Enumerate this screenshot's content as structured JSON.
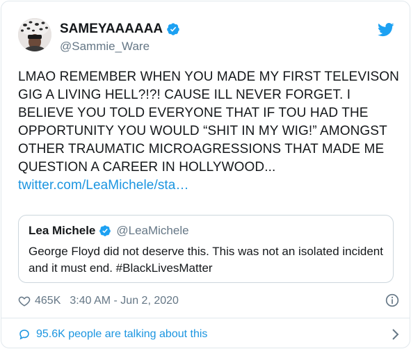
{
  "user": {
    "display_name": "SAMEYAAAAAA",
    "handle": "@Sammie_Ware",
    "avatar_icon": "leopard-print-avatar",
    "verified_icon": "verified-badge-icon"
  },
  "tweet": {
    "text": "LMAO REMEMBER WHEN YOU MADE MY FIRST TELEVISON GIG A LIVING HELL?!?! CAUSE ILL NEVER FORGET. I BELIEVE YOU TOLD EVERYONE THAT IF TOU HAD THE OPPORTUNITY YOU WOULD “SHIT IN MY WIG!” AMONGST OTHER TRAUMATIC MICROAGRESSIONS THAT MADE ME QUESTION A CAREER IN HOLLYWOOD...",
    "link": "twitter.com/LeaMichele/sta…"
  },
  "quote": {
    "name": "Lea Michele",
    "handle": "@LeaMichele",
    "text": "George Floyd did not deserve this. This was not an isolated incident and it must end. #BlackLivesMatter"
  },
  "footer": {
    "likes": "465K",
    "timestamp": "3:40 AM - Jun 2, 2020",
    "talking": "95.6K people are talking about this"
  },
  "colors": {
    "accent": "#1b95e0",
    "secondary_text": "#657786",
    "twitter_blue": "#1da1f2"
  }
}
